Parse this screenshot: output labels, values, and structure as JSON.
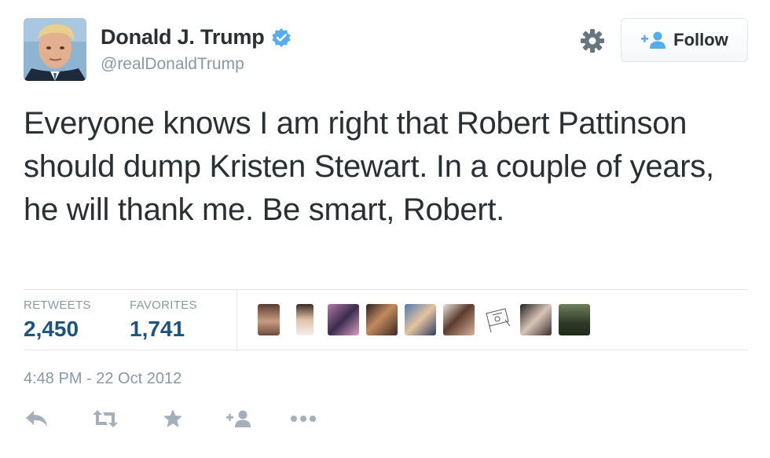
{
  "user": {
    "display_name": "Donald J. Trump",
    "handle": "@realDonaldTrump",
    "verified_icon": "verified-badge-icon",
    "avatar_icon": "profile-photo"
  },
  "header": {
    "settings_icon": "gear-icon",
    "follow_label": "Follow",
    "follow_icon": "add-user-icon"
  },
  "tweet": {
    "text": "Everyone knows I am right that Robert Pattinson should dump Kristen Stewart. In a couple of years, he will thank me. Be smart, Robert.",
    "timestamp": "4:48 PM - 22 Oct 2012"
  },
  "stats": {
    "retweets_label": "RETWEETS",
    "retweets_value": "2,450",
    "favorites_label": "FAVORITES",
    "favorites_value": "1,741"
  },
  "favoriters": [
    "favoriter-avatar-1",
    "favoriter-avatar-2",
    "favoriter-avatar-3",
    "favoriter-avatar-4",
    "favoriter-avatar-5",
    "favoriter-avatar-6",
    "favoriter-avatar-7",
    "favoriter-avatar-8",
    "favoriter-avatar-9"
  ],
  "actions": [
    "reply-icon",
    "retweet-icon",
    "favorite-star-icon",
    "add-user-icon",
    "more-dots-icon"
  ],
  "colors": {
    "text": "#292f33",
    "muted": "#8899a6",
    "stat_value": "#1c5480",
    "verified": "#55acee",
    "icon_gray": "#a3b0bb",
    "border": "#e1e8ed"
  }
}
